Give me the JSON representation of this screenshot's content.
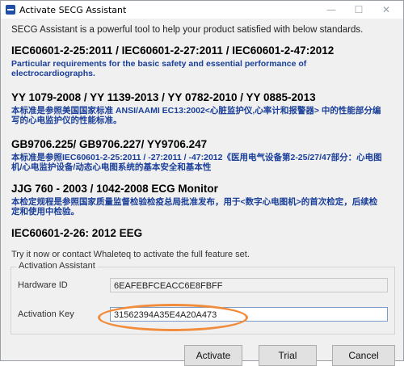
{
  "window": {
    "title": "Activate SECG Assistant",
    "controls": {
      "minimize": "—",
      "maximize": "☐",
      "close": "✕"
    }
  },
  "intro_text": "SECG Assistant is a powerful tool to help your product satisfied with  below standards.",
  "standards": [
    {
      "head": "IEC60601-2-25:2011 / IEC60601-2-27:2011 / IEC60601-2-47:2012",
      "desc": "Particular requirements for the basic safety and essential performance of electrocardiographs."
    },
    {
      "head": "YY 1079-2008 / YY 1139-2013 / YY 0782-2010 / YY 0885-2013",
      "desc": "本标准是参照美国国家标准 ANSI/AAMI EC13:2002<心脏监护仪,心率计和报警器> 中的性能部分编写的心电监护仪的性能标准。"
    },
    {
      "head": "GB9706.225/ GB9706.227/ YY9706.247",
      "desc": "本标准是参照IEC60601-2-25:2011 / -27:2011 / -47:2012《医用电气设备第2-25/27/47部分：心电图机/心电监护设备/动态心电图系统的基本安全和基本性"
    },
    {
      "head": "JJG 760 - 2003 / 1042-2008 ECG Monitor",
      "desc": "本检定规程是参照国家质量监督检验检疫总局批准发布，用于<数字心电图机>的首次检定，后续检定和使用中检验。"
    },
    {
      "head": "IEC60601-2-26: 2012 EEG",
      "desc": ""
    }
  ],
  "try_text": "Try it now or contact Whaleteq to activate the full feature set.",
  "activation": {
    "group_title": "Activation Assistant",
    "hardware_label": "Hardware ID",
    "hardware_id": "6EAFEBFCEACC6E8FBFF",
    "key_label": "Activation Key",
    "key_value": "31562394A35E4A20A473"
  },
  "buttons": {
    "activate": "Activate",
    "trial": "Trial",
    "cancel": "Cancel"
  },
  "colors": {
    "description_text": "#1a3f99",
    "highlight_ellipse": "#f08c3c"
  }
}
